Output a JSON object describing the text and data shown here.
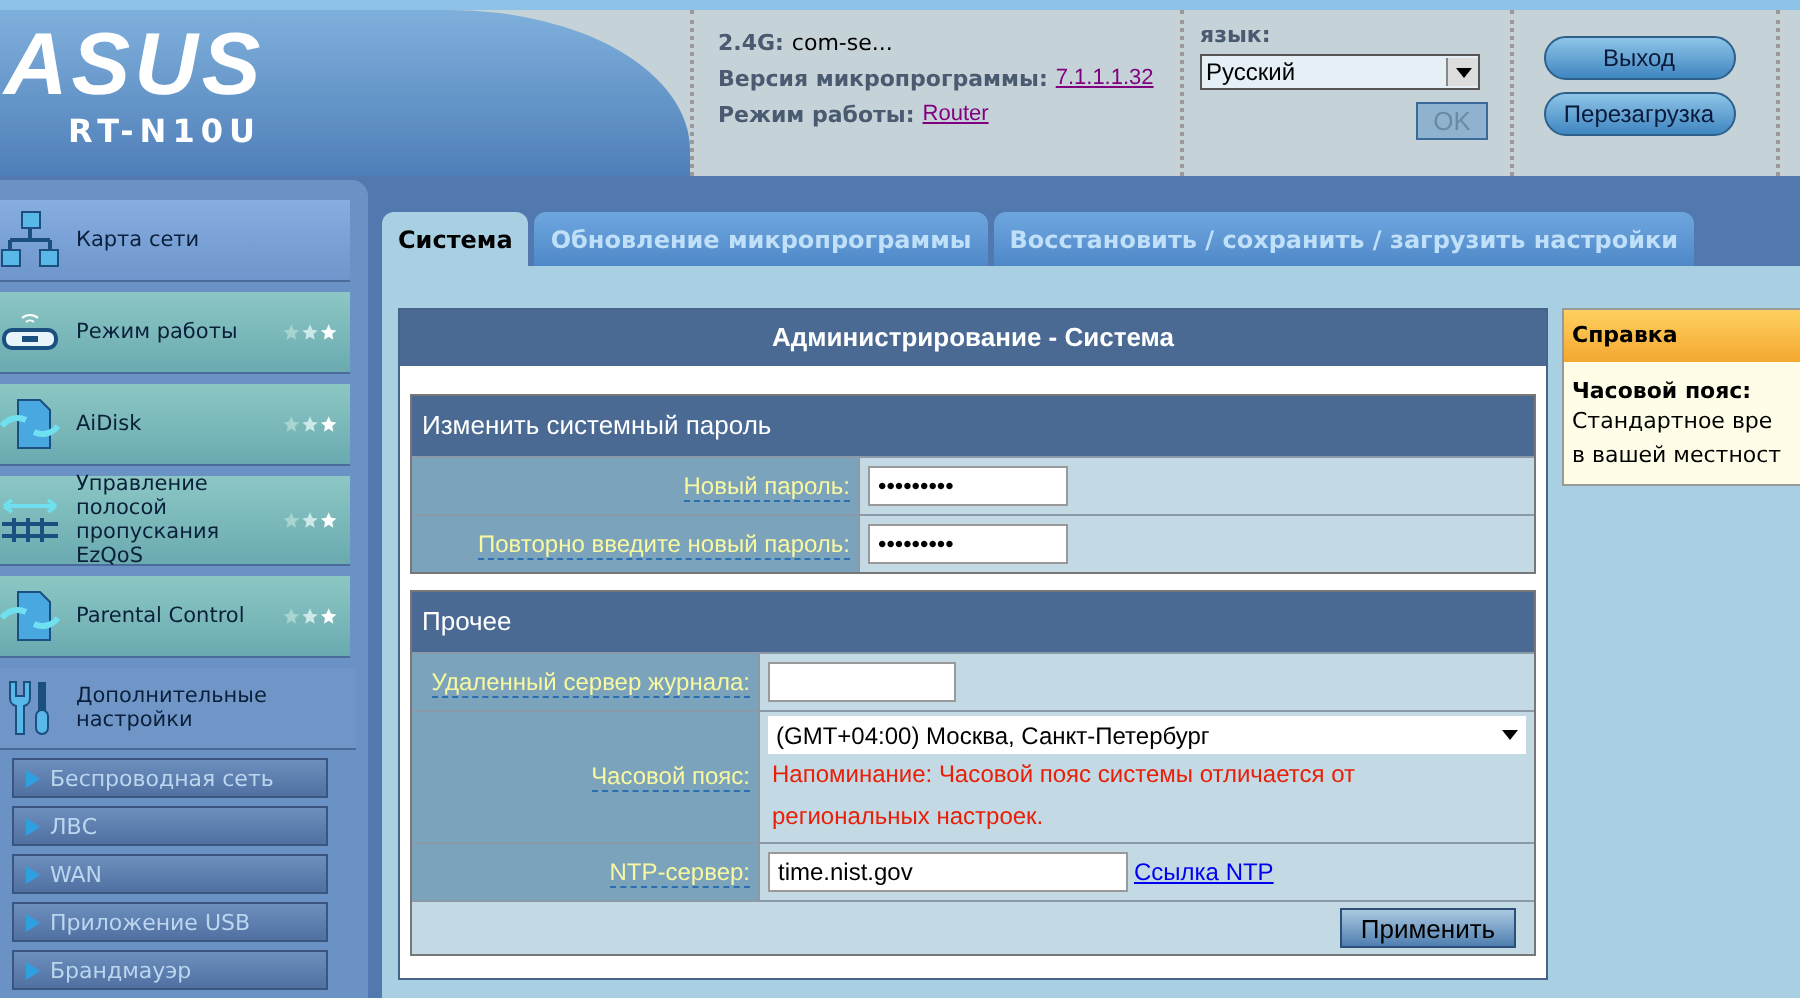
{
  "header": {
    "logo": "ASUS",
    "model": "RT-N10U",
    "info": [
      {
        "label": "2.4G:",
        "value": "com-se...",
        "kind": "plain"
      },
      {
        "label": "Версия микропрограммы:",
        "value": "7.1.1.1.32",
        "kind": "link"
      },
      {
        "label": "Режим работы:",
        "value": "Router",
        "kind": "link"
      }
    ],
    "language": {
      "label": "язык:",
      "value": "Русский",
      "ok": "OK",
      "ok_disabled": true
    },
    "buttons": [
      "Выход",
      "Перезагрузка"
    ]
  },
  "sidebar": {
    "items": [
      {
        "label": "Карта сети",
        "featured": false
      },
      {
        "label": "Режим работы",
        "featured": true
      },
      {
        "label": "AiDisk",
        "featured": true
      },
      {
        "label": "Управление полосой пропускания EzQoS",
        "featured": true
      },
      {
        "label": "Parental Control",
        "featured": true
      },
      {
        "label": "Дополнительные настройки",
        "featured": false
      }
    ],
    "sub_items": [
      "Беспроводная сеть",
      "ЛВС",
      "WAN",
      "Приложение USB",
      "Брандмауэр"
    ]
  },
  "tabs": [
    {
      "label": "Система",
      "selected": true
    },
    {
      "label": "Обновление микропрограммы",
      "selected": false
    },
    {
      "label": "Восстановить / сохранить / загрузить настройки",
      "selected": false
    }
  ],
  "panel": {
    "title": "Администрирование - Система",
    "groups": [
      {
        "title": "Изменить системный пароль",
        "fields": [
          {
            "label": "Новый пароль:",
            "kind": "password",
            "value": "•••••••••"
          },
          {
            "label": "Повторно введите новый пароль:",
            "kind": "password",
            "value": "•••••••••"
          }
        ]
      },
      {
        "title": "Прочее",
        "fields": [
          {
            "label": "Удаленный сервер журнала:",
            "kind": "text"
          },
          {
            "label": "Часовой пояс:",
            "kind": "select",
            "value": "(GMT+04:00) Москва, Санкт-Петербург",
            "note": "Напоминание: Часовой пояс системы отличается от региональных настроек."
          },
          {
            "label": "NTP-сервер:",
            "kind": "text",
            "value": "time.nist.gov",
            "link": "Ссылка NTP"
          }
        ]
      }
    ],
    "apply": "Применить"
  },
  "help": {
    "title": "Справка",
    "heading": "Часовой пояс:",
    "lines": [
      "Стандартное вре",
      "в вашей местност"
    ]
  }
}
